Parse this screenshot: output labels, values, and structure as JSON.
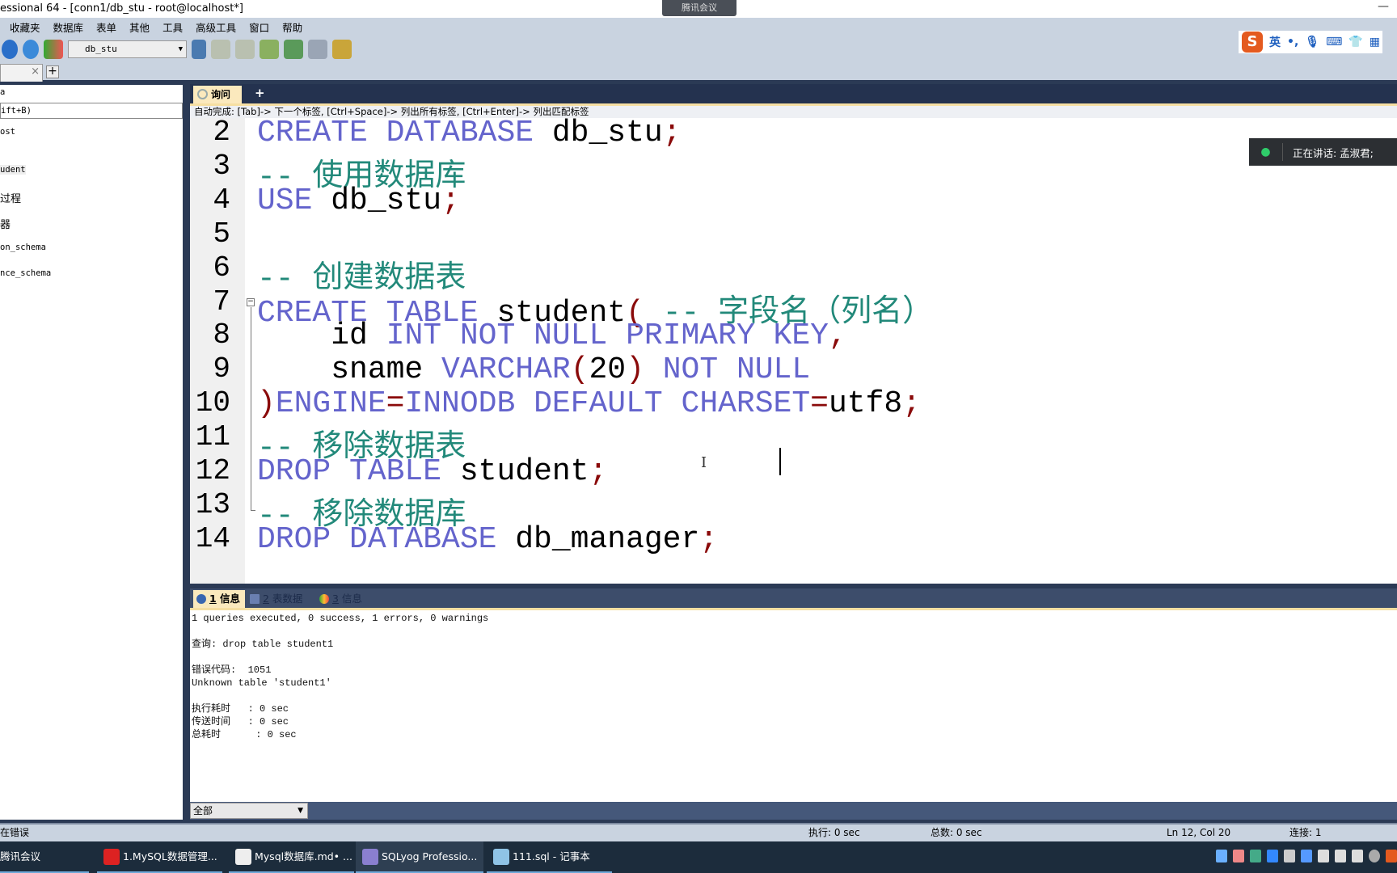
{
  "window": {
    "title": "essional 64 - [conn1/db_stu - root@localhost*]",
    "meeting_badge": "腾讯会议",
    "minimize": "—"
  },
  "menu": [
    "收藏夹",
    "数据库",
    "表单",
    "其他",
    "工具",
    "高级工具",
    "窗口",
    "帮助"
  ],
  "toolbar": {
    "database_select": "db_stu",
    "icons": [
      "forward-icon",
      "refresh-icon",
      "schema-icon",
      "user-icon",
      "import-icon",
      "export-icon",
      "backup-icon",
      "table-import-icon",
      "table-calc-icon",
      "table-key-icon"
    ]
  },
  "ime": {
    "logo": "S",
    "lang": "英",
    "punct": "•,"
  },
  "connection_tab": {
    "close": "×",
    "add": "+"
  },
  "object_browser": {
    "header": "a",
    "filter": "ift+B)",
    "items": [
      "ost",
      "udent",
      "过程",
      "器",
      "on_schema",
      "nce_schema"
    ]
  },
  "query_tab": {
    "label": "询问",
    "add": "+"
  },
  "hint": "自动完成: [Tab]-> 下一个标签, [Ctrl+Space]-> 列出所有标签, [Ctrl+Enter]-> 列出匹配标签",
  "editor": {
    "line_numbers": [
      "2",
      "3",
      "4",
      "5",
      "6",
      "7",
      "8",
      "9",
      "10",
      "11",
      "12",
      "13",
      "14"
    ],
    "lines": [
      [
        {
          "t": "CREATE DATABASE",
          "c": "kw"
        },
        {
          "t": " db_stu"
        },
        {
          "t": ";",
          "c": "pn"
        }
      ],
      [
        {
          "t": "-- 使用数据库",
          "c": "cm"
        }
      ],
      [
        {
          "t": "USE",
          "c": "kw"
        },
        {
          "t": " db_stu"
        },
        {
          "t": ";",
          "c": "pn"
        }
      ],
      [],
      [
        {
          "t": "-- 创建数据表",
          "c": "cm"
        }
      ],
      [
        {
          "t": "CREATE TABLE",
          "c": "kw"
        },
        {
          "t": " student"
        },
        {
          "t": "(",
          "c": "pn"
        },
        {
          "t": " -- 字段名（列名）",
          "c": "cm"
        }
      ],
      [
        {
          "t": "    id "
        },
        {
          "t": "INT NOT NULL PRIMARY KEY",
          "c": "kw"
        },
        {
          "t": ",",
          "c": "pn"
        }
      ],
      [
        {
          "t": "    sname "
        },
        {
          "t": "VARCHAR",
          "c": "kw"
        },
        {
          "t": "(",
          "c": "pn"
        },
        {
          "t": "20"
        },
        {
          "t": ")",
          "c": "pn"
        },
        {
          "t": " "
        },
        {
          "t": "NOT NULL",
          "c": "kw"
        }
      ],
      [
        {
          "t": ")",
          "c": "pn"
        },
        {
          "t": "ENGINE",
          "c": "kw"
        },
        {
          "t": "=",
          "c": "pn"
        },
        {
          "t": "INNODB DEFAULT CHARSET",
          "c": "kw"
        },
        {
          "t": "=",
          "c": "pn"
        },
        {
          "t": "utf8"
        },
        {
          "t": ";",
          "c": "pn"
        }
      ],
      [
        {
          "t": "-- 移除数据表",
          "c": "cm"
        }
      ],
      [
        {
          "t": "DROP TABLE",
          "c": "kw"
        },
        {
          "t": " student"
        },
        {
          "t": ";",
          "c": "pn"
        }
      ],
      [
        {
          "t": "-- 移除数据库",
          "c": "cm"
        }
      ],
      [
        {
          "t": "DROP DATABASE",
          "c": "kw"
        },
        {
          "t": " db_manager"
        },
        {
          "t": ";",
          "c": "pn"
        }
      ]
    ],
    "colors": {
      "keyword": "#6464cc",
      "comment": "#22897a",
      "punctuation": "#8a0a0a"
    }
  },
  "speaking": {
    "text": "正在讲话: 孟淑君;"
  },
  "result_tabs": [
    {
      "num": "1",
      "label": " 信息"
    },
    {
      "num": "2",
      "label": " 表数据"
    },
    {
      "num": "3",
      "label": " 信息"
    }
  ],
  "results": {
    "text": "1 queries executed, 0 success, 1 errors, 0 warnings\n\n查询: drop table student1\n\n错误代码:  1051\nUnknown table 'student1'\n\n执行耗时   : 0 sec\n传送时间   : 0 sec\n总耗时      : 0 sec"
  },
  "result_filter": "全部",
  "status": {
    "left": "在错误",
    "exec": "执行: 0 sec",
    "total": "总数: 0 sec",
    "position": "Ln 12, Col 20",
    "connections": "连接: 1"
  },
  "taskbar": [
    {
      "label": "腾讯会议"
    },
    {
      "label": "1.MySQL数据管理..."
    },
    {
      "label": "Mysql数据库.md• ..."
    },
    {
      "label": "SQLyog Professio..."
    },
    {
      "label": "111.sql - 记事本"
    }
  ]
}
